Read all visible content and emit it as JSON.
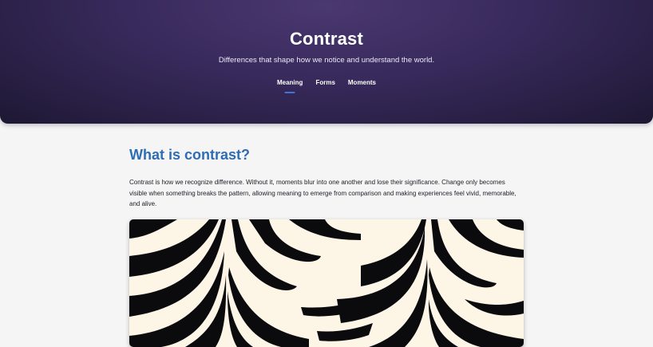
{
  "hero": {
    "title": "Contrast",
    "subtitle": "Differences that shape how we notice and understand the world."
  },
  "nav": {
    "items": [
      {
        "label": "Meaning",
        "active": true
      },
      {
        "label": "Forms",
        "active": false
      },
      {
        "label": "Moments",
        "active": false
      }
    ]
  },
  "section": {
    "heading": "What is contrast?",
    "body": "Contrast is how we recognize difference. Without it, moments blur into one another and lose their significance. Change only becomes visible when something breaks the pattern, allowing meaning to emerge from comparison and making experiences feel vivid, memorable, and alive."
  },
  "colors": {
    "accent": "#2e6db3",
    "nav_indicator": "#3f74d8",
    "hero_bg": "#3a2b5e",
    "stripe_dark": "#0b0b0e",
    "stripe_light": "#fdf6e7"
  },
  "image": {
    "icon": "op-art-stripes-image"
  }
}
